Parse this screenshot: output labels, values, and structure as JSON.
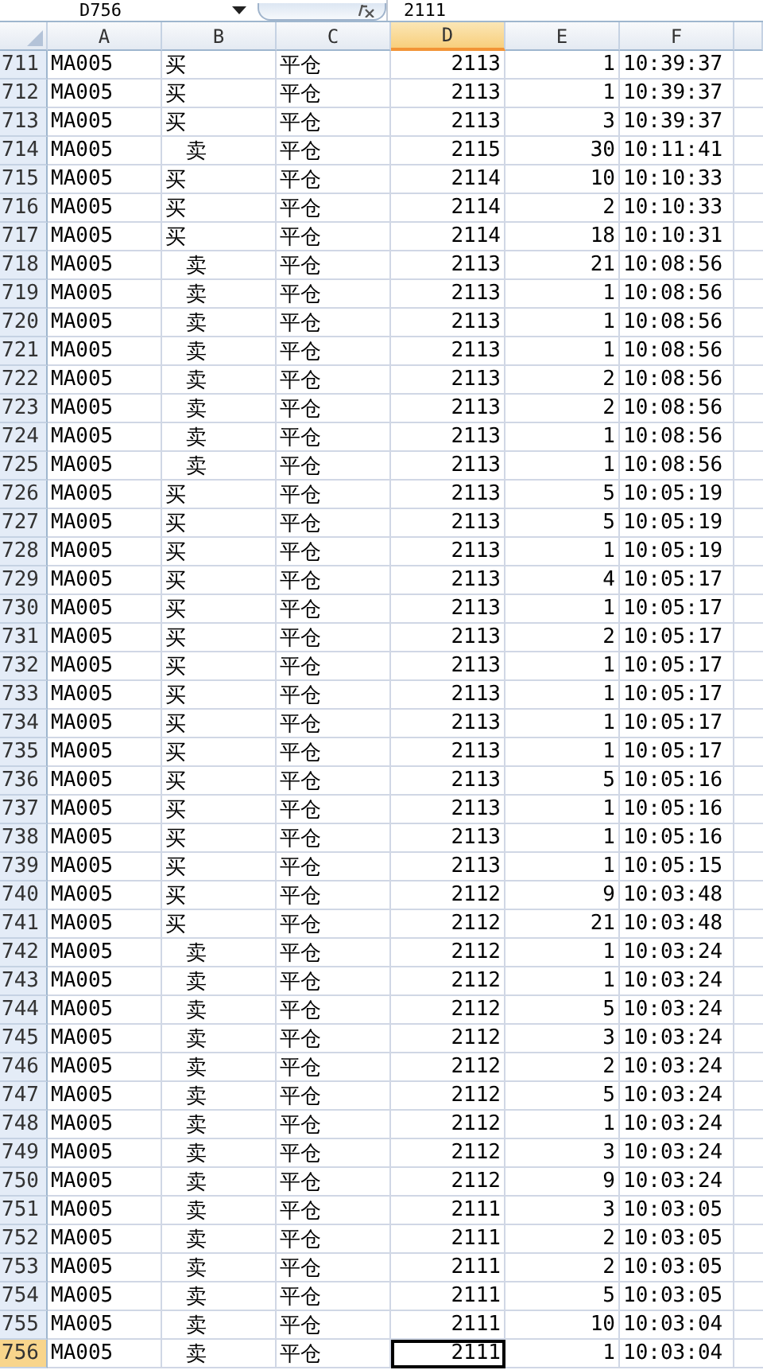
{
  "formula_bar": {
    "name_box": "D756",
    "value": "2111"
  },
  "columns": [
    {
      "label": "A",
      "selected": false
    },
    {
      "label": "B",
      "selected": false
    },
    {
      "label": "C",
      "selected": false
    },
    {
      "label": "D",
      "selected": true
    },
    {
      "label": "E",
      "selected": false
    },
    {
      "label": "F",
      "selected": false
    }
  ],
  "rows": [
    {
      "header": "711",
      "b_indented": false,
      "selected": false,
      "cells": [
        "MA005",
        "买",
        "平仓",
        "2113",
        "1",
        "10:39:37"
      ]
    },
    {
      "header": "712",
      "b_indented": false,
      "selected": false,
      "cells": [
        "MA005",
        "买",
        "平仓",
        "2113",
        "1",
        "10:39:37"
      ]
    },
    {
      "header": "713",
      "b_indented": false,
      "selected": false,
      "cells": [
        "MA005",
        "买",
        "平仓",
        "2113",
        "3",
        "10:39:37"
      ]
    },
    {
      "header": "714",
      "b_indented": true,
      "selected": false,
      "cells": [
        "MA005",
        "卖",
        "平仓",
        "2115",
        "30",
        "10:11:41"
      ]
    },
    {
      "header": "715",
      "b_indented": false,
      "selected": false,
      "cells": [
        "MA005",
        "买",
        "平仓",
        "2114",
        "10",
        "10:10:33"
      ]
    },
    {
      "header": "716",
      "b_indented": false,
      "selected": false,
      "cells": [
        "MA005",
        "买",
        "平仓",
        "2114",
        "2",
        "10:10:33"
      ]
    },
    {
      "header": "717",
      "b_indented": false,
      "selected": false,
      "cells": [
        "MA005",
        "买",
        "平仓",
        "2114",
        "18",
        "10:10:31"
      ]
    },
    {
      "header": "718",
      "b_indented": true,
      "selected": false,
      "cells": [
        "MA005",
        "卖",
        "平仓",
        "2113",
        "21",
        "10:08:56"
      ]
    },
    {
      "header": "719",
      "b_indented": true,
      "selected": false,
      "cells": [
        "MA005",
        "卖",
        "平仓",
        "2113",
        "1",
        "10:08:56"
      ]
    },
    {
      "header": "720",
      "b_indented": true,
      "selected": false,
      "cells": [
        "MA005",
        "卖",
        "平仓",
        "2113",
        "1",
        "10:08:56"
      ]
    },
    {
      "header": "721",
      "b_indented": true,
      "selected": false,
      "cells": [
        "MA005",
        "卖",
        "平仓",
        "2113",
        "1",
        "10:08:56"
      ]
    },
    {
      "header": "722",
      "b_indented": true,
      "selected": false,
      "cells": [
        "MA005",
        "卖",
        "平仓",
        "2113",
        "2",
        "10:08:56"
      ]
    },
    {
      "header": "723",
      "b_indented": true,
      "selected": false,
      "cells": [
        "MA005",
        "卖",
        "平仓",
        "2113",
        "2",
        "10:08:56"
      ]
    },
    {
      "header": "724",
      "b_indented": true,
      "selected": false,
      "cells": [
        "MA005",
        "卖",
        "平仓",
        "2113",
        "1",
        "10:08:56"
      ]
    },
    {
      "header": "725",
      "b_indented": true,
      "selected": false,
      "cells": [
        "MA005",
        "卖",
        "平仓",
        "2113",
        "1",
        "10:08:56"
      ]
    },
    {
      "header": "726",
      "b_indented": false,
      "selected": false,
      "cells": [
        "MA005",
        "买",
        "平仓",
        "2113",
        "5",
        "10:05:19"
      ]
    },
    {
      "header": "727",
      "b_indented": false,
      "selected": false,
      "cells": [
        "MA005",
        "买",
        "平仓",
        "2113",
        "5",
        "10:05:19"
      ]
    },
    {
      "header": "728",
      "b_indented": false,
      "selected": false,
      "cells": [
        "MA005",
        "买",
        "平仓",
        "2113",
        "1",
        "10:05:19"
      ]
    },
    {
      "header": "729",
      "b_indented": false,
      "selected": false,
      "cells": [
        "MA005",
        "买",
        "平仓",
        "2113",
        "4",
        "10:05:17"
      ]
    },
    {
      "header": "730",
      "b_indented": false,
      "selected": false,
      "cells": [
        "MA005",
        "买",
        "平仓",
        "2113",
        "1",
        "10:05:17"
      ]
    },
    {
      "header": "731",
      "b_indented": false,
      "selected": false,
      "cells": [
        "MA005",
        "买",
        "平仓",
        "2113",
        "2",
        "10:05:17"
      ]
    },
    {
      "header": "732",
      "b_indented": false,
      "selected": false,
      "cells": [
        "MA005",
        "买",
        "平仓",
        "2113",
        "1",
        "10:05:17"
      ]
    },
    {
      "header": "733",
      "b_indented": false,
      "selected": false,
      "cells": [
        "MA005",
        "买",
        "平仓",
        "2113",
        "1",
        "10:05:17"
      ]
    },
    {
      "header": "734",
      "b_indented": false,
      "selected": false,
      "cells": [
        "MA005",
        "买",
        "平仓",
        "2113",
        "1",
        "10:05:17"
      ]
    },
    {
      "header": "735",
      "b_indented": false,
      "selected": false,
      "cells": [
        "MA005",
        "买",
        "平仓",
        "2113",
        "1",
        "10:05:17"
      ]
    },
    {
      "header": "736",
      "b_indented": false,
      "selected": false,
      "cells": [
        "MA005",
        "买",
        "平仓",
        "2113",
        "5",
        "10:05:16"
      ]
    },
    {
      "header": "737",
      "b_indented": false,
      "selected": false,
      "cells": [
        "MA005",
        "买",
        "平仓",
        "2113",
        "1",
        "10:05:16"
      ]
    },
    {
      "header": "738",
      "b_indented": false,
      "selected": false,
      "cells": [
        "MA005",
        "买",
        "平仓",
        "2113",
        "1",
        "10:05:16"
      ]
    },
    {
      "header": "739",
      "b_indented": false,
      "selected": false,
      "cells": [
        "MA005",
        "买",
        "平仓",
        "2113",
        "1",
        "10:05:15"
      ]
    },
    {
      "header": "740",
      "b_indented": false,
      "selected": false,
      "cells": [
        "MA005",
        "买",
        "平仓",
        "2112",
        "9",
        "10:03:48"
      ]
    },
    {
      "header": "741",
      "b_indented": false,
      "selected": false,
      "cells": [
        "MA005",
        "买",
        "平仓",
        "2112",
        "21",
        "10:03:48"
      ]
    },
    {
      "header": "742",
      "b_indented": true,
      "selected": false,
      "cells": [
        "MA005",
        "卖",
        "平仓",
        "2112",
        "1",
        "10:03:24"
      ]
    },
    {
      "header": "743",
      "b_indented": true,
      "selected": false,
      "cells": [
        "MA005",
        "卖",
        "平仓",
        "2112",
        "1",
        "10:03:24"
      ]
    },
    {
      "header": "744",
      "b_indented": true,
      "selected": false,
      "cells": [
        "MA005",
        "卖",
        "平仓",
        "2112",
        "5",
        "10:03:24"
      ]
    },
    {
      "header": "745",
      "b_indented": true,
      "selected": false,
      "cells": [
        "MA005",
        "卖",
        "平仓",
        "2112",
        "3",
        "10:03:24"
      ]
    },
    {
      "header": "746",
      "b_indented": true,
      "selected": false,
      "cells": [
        "MA005",
        "卖",
        "平仓",
        "2112",
        "2",
        "10:03:24"
      ]
    },
    {
      "header": "747",
      "b_indented": true,
      "selected": false,
      "cells": [
        "MA005",
        "卖",
        "平仓",
        "2112",
        "5",
        "10:03:24"
      ]
    },
    {
      "header": "748",
      "b_indented": true,
      "selected": false,
      "cells": [
        "MA005",
        "卖",
        "平仓",
        "2112",
        "1",
        "10:03:24"
      ]
    },
    {
      "header": "749",
      "b_indented": true,
      "selected": false,
      "cells": [
        "MA005",
        "卖",
        "平仓",
        "2112",
        "3",
        "10:03:24"
      ]
    },
    {
      "header": "750",
      "b_indented": true,
      "selected": false,
      "cells": [
        "MA005",
        "卖",
        "平仓",
        "2112",
        "9",
        "10:03:24"
      ]
    },
    {
      "header": "751",
      "b_indented": true,
      "selected": false,
      "cells": [
        "MA005",
        "卖",
        "平仓",
        "2111",
        "3",
        "10:03:05"
      ]
    },
    {
      "header": "752",
      "b_indented": true,
      "selected": false,
      "cells": [
        "MA005",
        "卖",
        "平仓",
        "2111",
        "2",
        "10:03:05"
      ]
    },
    {
      "header": "753",
      "b_indented": true,
      "selected": false,
      "cells": [
        "MA005",
        "卖",
        "平仓",
        "2111",
        "2",
        "10:03:05"
      ]
    },
    {
      "header": "754",
      "b_indented": true,
      "selected": false,
      "cells": [
        "MA005",
        "卖",
        "平仓",
        "2111",
        "5",
        "10:03:05"
      ]
    },
    {
      "header": "755",
      "b_indented": true,
      "selected": false,
      "cells": [
        "MA005",
        "卖",
        "平仓",
        "2111",
        "10",
        "10:03:04"
      ]
    },
    {
      "header": "756",
      "b_indented": true,
      "selected": true,
      "cells": [
        "MA005",
        "卖",
        "平仓",
        "2111",
        "1",
        "10:03:04"
      ]
    }
  ]
}
